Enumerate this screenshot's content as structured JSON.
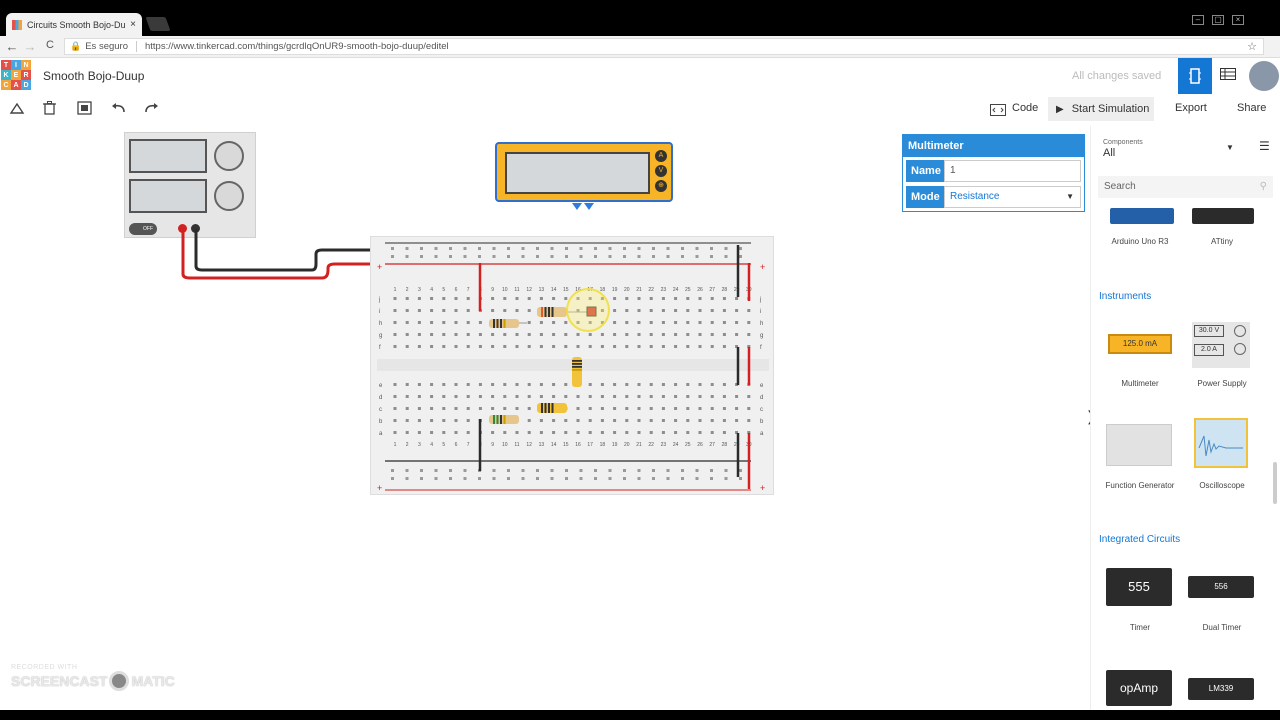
{
  "browser": {
    "tab_title": "Circuits Smooth Bojo-Du",
    "tab_close": "×",
    "secure_label": "Es seguro",
    "url": "https://www.tinkercad.com/things/gcrdlqOnUR9-smooth-bojo-duup/editel",
    "nav": {
      "back": "←",
      "forward": "→",
      "reload": "C"
    },
    "star": "☆",
    "window_controls": [
      "–",
      "▢",
      "×"
    ]
  },
  "app": {
    "logo_letters": [
      "T",
      "I",
      "N",
      "K",
      "E",
      "R",
      "C",
      "A",
      "D"
    ],
    "logo_colors": [
      "#e2524b",
      "#4aa6e0",
      "#f2a33a",
      "#3cb5c8",
      "#f2a33a",
      "#e2524b",
      "#f2a33a",
      "#e2524b",
      "#4aa6e0"
    ],
    "title": "Smooth Bojo-Duup",
    "saved_status": "All changes saved",
    "circuit_view_icon": "circuit-view-icon",
    "list_view_icon": "list-view-icon"
  },
  "toolbar": {
    "rotate_icon": "rotate-icon",
    "delete_icon": "trash-icon",
    "fit_icon": "fit-view-icon",
    "undo_icon": "undo-icon",
    "redo_icon": "redo-icon",
    "code_label": "Code",
    "start_simulation_label": "Start Simulation",
    "export_label": "Export",
    "share_label": "Share"
  },
  "inspector": {
    "header": "Multimeter",
    "name_label": "Name",
    "name_value": "1",
    "mode_label": "Mode",
    "mode_value": "Resistance"
  },
  "multimeter_ports": [
    "A",
    "V",
    "⊕"
  ],
  "psu_toggle": "OFF",
  "breadboard": {
    "column_numbers": [
      "1",
      "2",
      "3",
      "4",
      "5",
      "6",
      "7",
      "8",
      "9",
      "10",
      "11",
      "12",
      "13",
      "14",
      "15",
      "16",
      "17",
      "18",
      "19",
      "20",
      "21",
      "22",
      "23",
      "24",
      "25",
      "26",
      "27",
      "28",
      "29",
      "30"
    ],
    "top_rows": [
      "j",
      "i",
      "h",
      "g",
      "f"
    ],
    "bottom_rows": [
      "e",
      "d",
      "c",
      "b",
      "a"
    ],
    "rail_plus": "+",
    "rail_minus": "−"
  },
  "panel": {
    "components_label": "Components",
    "components_value": "All",
    "search_placeholder": "Search",
    "top_items": [
      {
        "label": "Arduino Uno R3"
      },
      {
        "label": "ATtiny"
      }
    ],
    "instruments_title": "Instruments",
    "instruments": [
      {
        "label": "Multimeter",
        "display": "125.0 mA"
      },
      {
        "label": "Power Supply",
        "display_v": "30.0 V",
        "display_a": "2.0 A"
      },
      {
        "label": "Function Generator"
      },
      {
        "label": "Oscilloscope"
      }
    ],
    "ic_title": "Integrated Circuits",
    "ics": [
      {
        "label": "Timer",
        "chip": "555"
      },
      {
        "label": "Dual Timer",
        "chip": "556"
      },
      {
        "label": "",
        "chip": "opAmp"
      },
      {
        "label": "",
        "chip": "LM339"
      }
    ]
  },
  "watermark": {
    "line1": "RECORDED WITH",
    "line2a": "SCREENCAST",
    "line2b": "MATIC"
  }
}
